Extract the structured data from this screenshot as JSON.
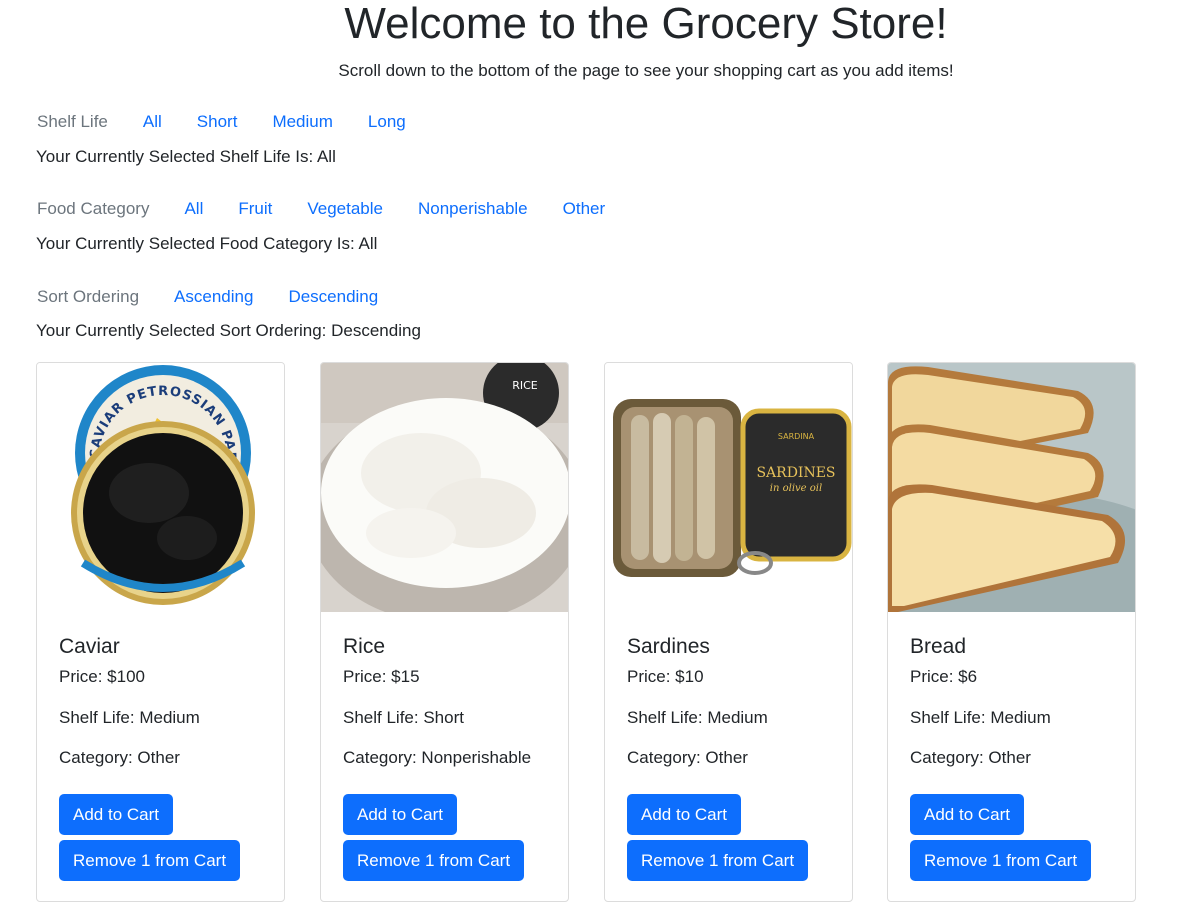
{
  "header": {
    "title": "Welcome to the Grocery Store!",
    "subtitle": "Scroll down to the bottom of the page to see your shopping cart as you add items!"
  },
  "filters": {
    "shelf_life": {
      "label": "Shelf Life",
      "options": [
        "All",
        "Short",
        "Medium",
        "Long"
      ],
      "selected_text": "Your Currently Selected Shelf Life Is: All"
    },
    "food_category": {
      "label": "Food Category",
      "options": [
        "All",
        "Fruit",
        "Vegetable",
        "Nonperishable",
        "Other"
      ],
      "selected_text": "Your Currently Selected Food Category Is: All"
    },
    "sort_ordering": {
      "label": "Sort Ordering",
      "options": [
        "Ascending",
        "Descending"
      ],
      "selected_text": "Your Currently Selected Sort Ordering: Descending"
    }
  },
  "products": [
    {
      "name": "Caviar",
      "price": "Price: $100",
      "shelf_life": "Shelf Life: Medium",
      "category": "Category: Other",
      "add_label": "Add to Cart",
      "remove_label": "Remove 1 from Cart"
    },
    {
      "name": "Rice",
      "price": "Price: $15",
      "shelf_life": "Shelf Life: Short",
      "category": "Category: Nonperishable",
      "add_label": "Add to Cart",
      "remove_label": "Remove 1 from Cart"
    },
    {
      "name": "Sardines",
      "price": "Price: $10",
      "shelf_life": "Shelf Life: Medium",
      "category": "Category: Other",
      "add_label": "Add to Cart",
      "remove_label": "Remove 1 from Cart"
    },
    {
      "name": "Bread",
      "price": "Price: $6",
      "shelf_life": "Shelf Life: Medium",
      "category": "Category: Other",
      "add_label": "Add to Cart",
      "remove_label": "Remove 1 from Cart"
    }
  ],
  "image_text": {
    "caviar_lid": "CAVIAR PETROSSIAN PARIS",
    "rice_jar": "RICE",
    "sardine_tin": "SARDINES",
    "sardine_tin_sub": "in olive oil",
    "sardine_brand": "SARDINA"
  },
  "colors": {
    "primary": "#0d6efd",
    "muted": "#6c757d",
    "text": "#212529"
  }
}
